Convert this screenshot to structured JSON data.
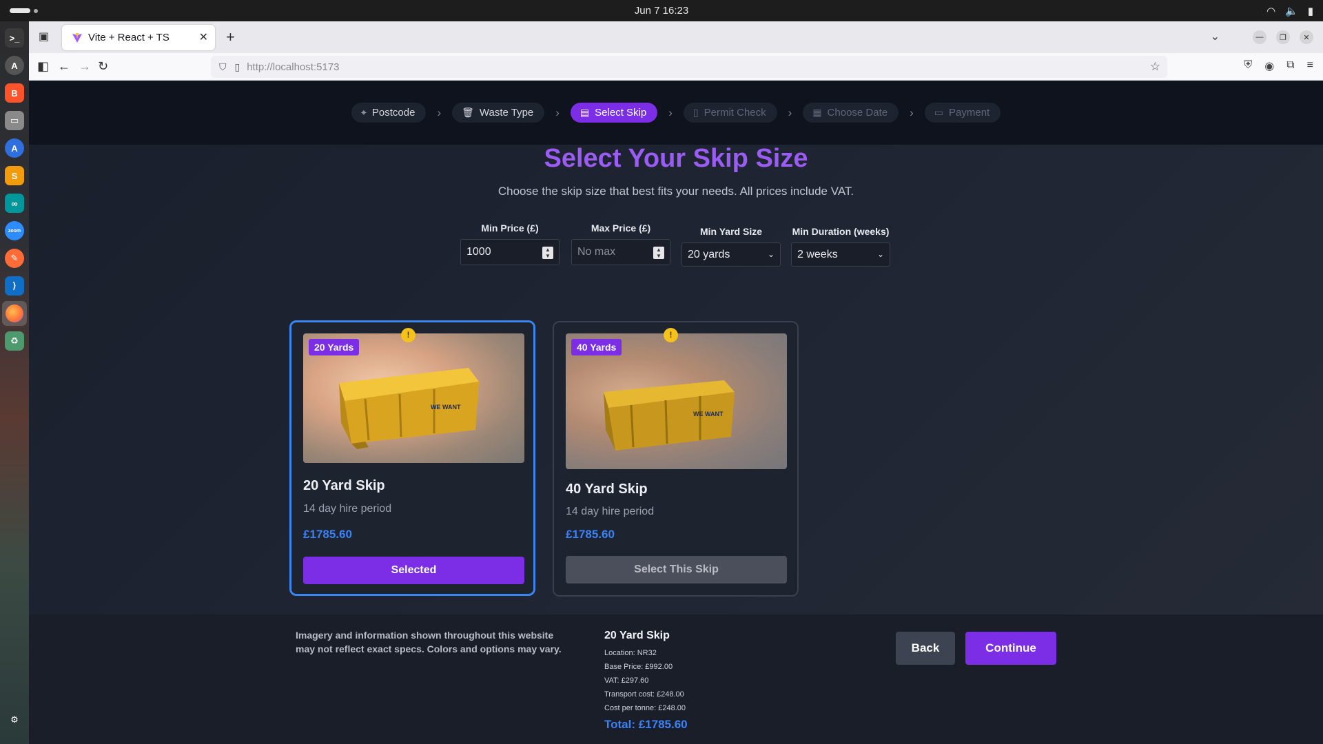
{
  "os": {
    "clock": "Jun 7  16:23"
  },
  "browser": {
    "tab_title": "Vite + React + TS",
    "url_host": "http://localhost",
    "url_port": ":5173"
  },
  "stepper": {
    "steps": [
      {
        "label": "Postcode",
        "icon": "map-pin-icon",
        "state": "done"
      },
      {
        "label": "Waste Type",
        "icon": "trash-icon",
        "state": "done"
      },
      {
        "label": "Select Skip",
        "icon": "clipboard-icon",
        "state": "active"
      },
      {
        "label": "Permit Check",
        "icon": "document-icon",
        "state": "disabled"
      },
      {
        "label": "Choose Date",
        "icon": "calendar-icon",
        "state": "disabled"
      },
      {
        "label": "Payment",
        "icon": "credit-card-icon",
        "state": "disabled"
      }
    ]
  },
  "header": {
    "title": "Select Your Skip Size",
    "subtitle": "Choose the skip size that best fits your needs. All prices include VAT."
  },
  "filters": {
    "min_price_label": "Min Price (£)",
    "min_price_value": "1000",
    "max_price_label": "Max Price (£)",
    "max_price_placeholder": "No max",
    "min_yard_label": "Min Yard Size",
    "min_yard_value": "20 yards",
    "min_duration_label": "Min Duration (weeks)",
    "min_duration_value": "2 weeks"
  },
  "skips": [
    {
      "badge": "20 Yards",
      "name": "20 Yard Skip",
      "period": "14 day hire period",
      "price": "£1785.60",
      "button": "Selected",
      "selected": true
    },
    {
      "badge": "40 Yards",
      "name": "40 Yard Skip",
      "period": "14 day hire period",
      "price": "£1785.60",
      "button": "Select This Skip",
      "selected": false
    }
  ],
  "footer": {
    "disclaimer": "Imagery and information shown throughout this website may not reflect exact specs. Colors and options may vary.",
    "summary_title": "20 Yard Skip",
    "location": "Location: NR32",
    "base_price": "Base Price: £992.00",
    "vat": "VAT: £297.60",
    "transport": "Transport cost: £248.00",
    "per_tonne": "Cost per tonne: £248.00",
    "total": "Total: £1785.60",
    "back_label": "Back",
    "continue_label": "Continue"
  },
  "colors": {
    "accent": "#7c2ee6",
    "price": "#3b82f6",
    "selected_border": "#3a86f0"
  }
}
